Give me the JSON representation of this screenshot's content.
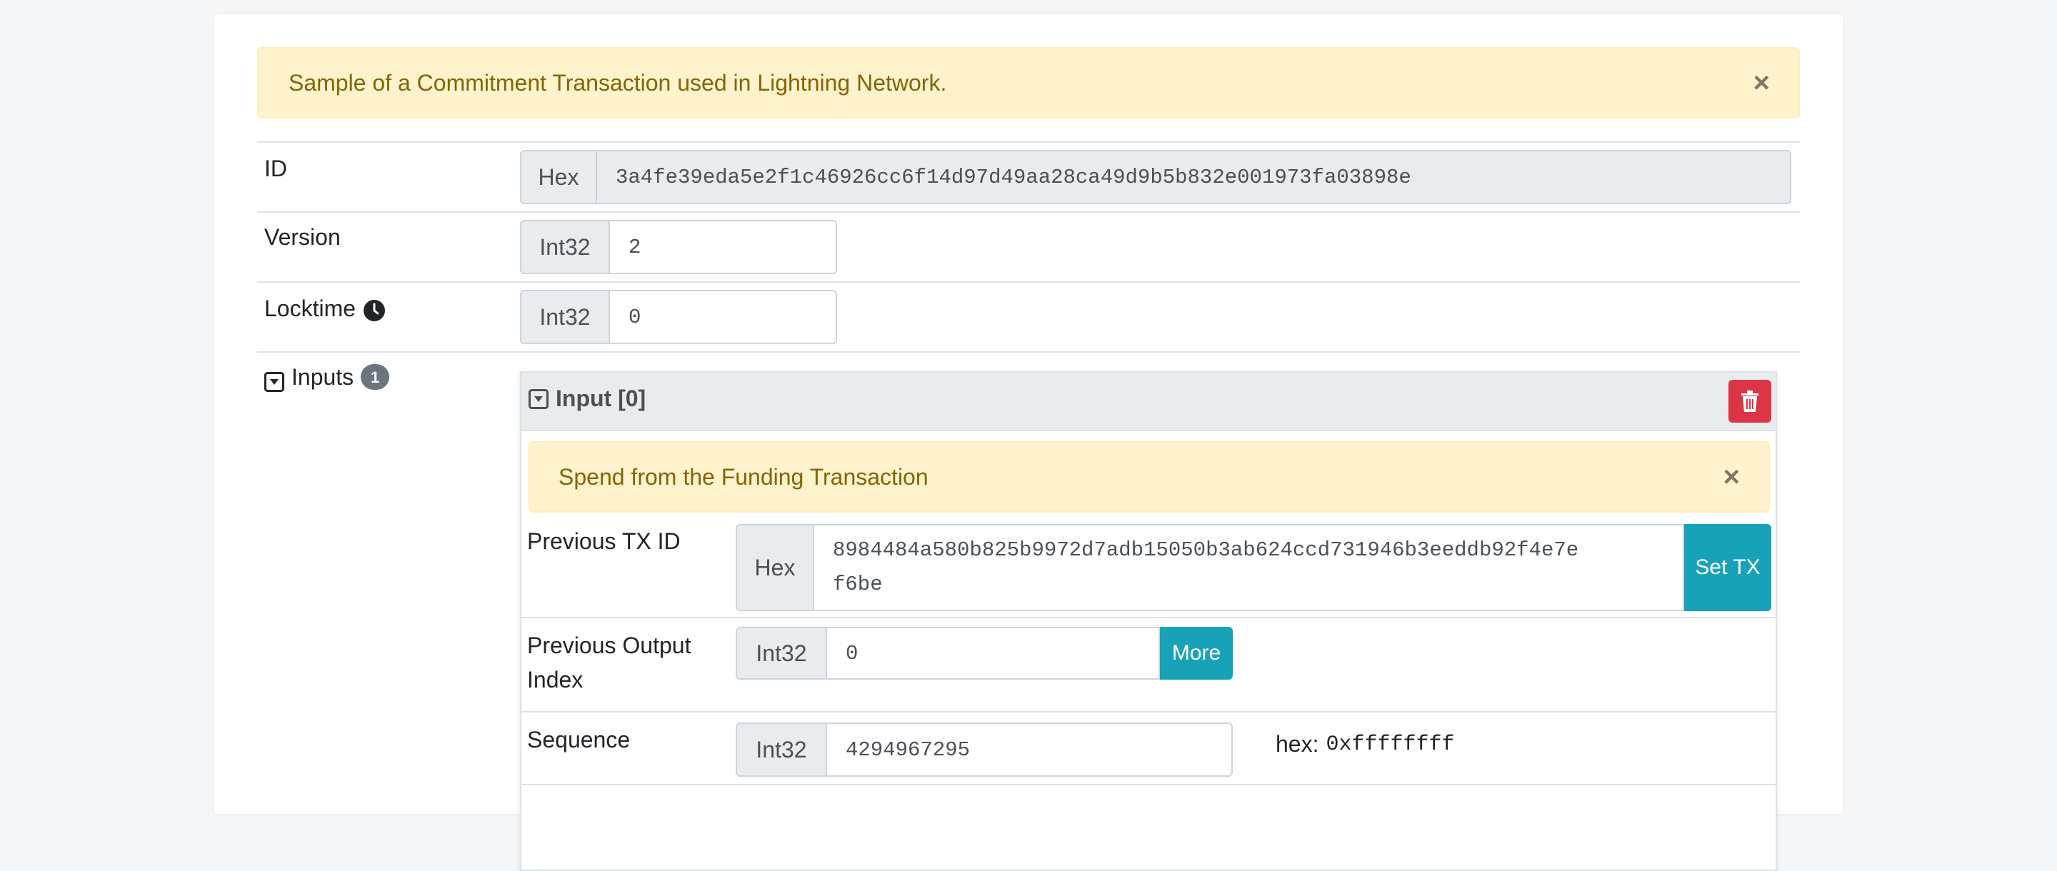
{
  "top_alert": {
    "message": "Sample of a Commitment Transaction used in Lightning Network.",
    "close": "×"
  },
  "fields": {
    "id": {
      "label": "ID",
      "type": "Hex",
      "value": "3a4fe39eda5e2f1c46926cc6f14d97d49aa28ca49d9b5b832e001973fa03898e"
    },
    "version": {
      "label": "Version",
      "type": "Int32",
      "value": "2"
    },
    "locktime": {
      "label": "Locktime",
      "type": "Int32",
      "value": "0"
    }
  },
  "inputs": {
    "label": "Inputs",
    "count": "1",
    "input0": {
      "title": "Input [0]",
      "alert": {
        "message": "Spend from the Funding Transaction",
        "close": "×"
      },
      "prev_txid": {
        "label": "Previous TX ID",
        "type": "Hex",
        "line1": "8984484a580b825b9972d7adb15050b3ab624ccd731946b3eeddb92f4e7e",
        "line2": "f6be",
        "button": "Set TX"
      },
      "prev_index": {
        "label_line1": "Previous Output",
        "label_line2": "Index",
        "type": "Int32",
        "value": "0",
        "button": "More"
      },
      "sequence": {
        "label": "Sequence",
        "type": "Int32",
        "value": "4294967295",
        "hex_label": "hex:",
        "hex_value": "0xffffffff"
      }
    }
  },
  "colors": {
    "alert_bg": "#fff3cd",
    "info": "#17a2b8",
    "danger": "#dc3545",
    "badge": "#6c757d"
  }
}
